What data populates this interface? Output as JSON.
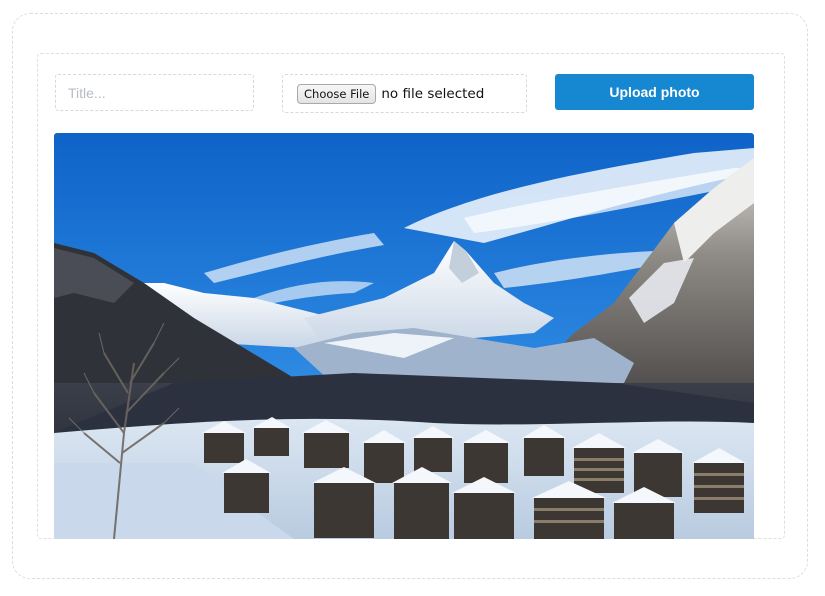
{
  "form": {
    "title_placeholder": "Title...",
    "title_value": "",
    "choose_file_label": "Choose File",
    "file_status": "no file selected",
    "upload_label": "Upload photo"
  },
  "colors": {
    "accent": "#1588d1",
    "border": "#d5d9df"
  },
  "photo": {
    "alt": "Snowy mountain village beneath a peak under a blue sky"
  }
}
